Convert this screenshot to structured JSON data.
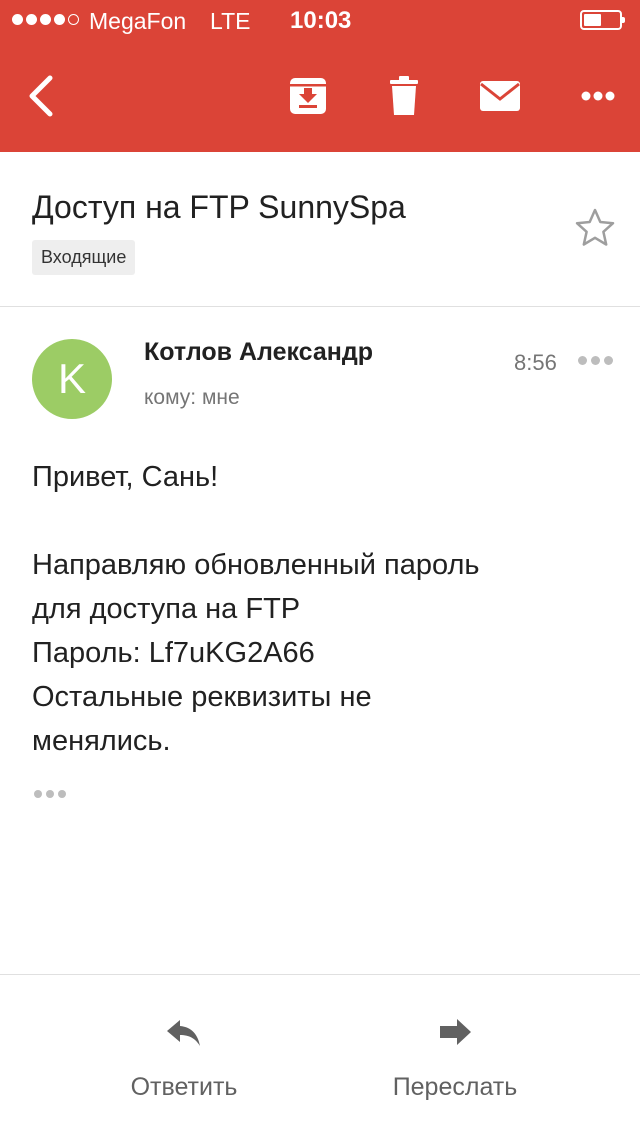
{
  "status_bar": {
    "carrier": "MegaFon",
    "network": "LTE",
    "time": "10:03",
    "signal_bars_filled": 4,
    "signal_bars_total": 5,
    "battery_level_fraction": 0.5
  },
  "toolbar": {
    "back_icon": "chevron-left-icon",
    "archive_icon": "archive-icon",
    "delete_icon": "trash-icon",
    "mark_unread_icon": "mail-icon",
    "more_icon": "more-horizontal-icon"
  },
  "email": {
    "subject": "Доступ на FTP SunnySpa",
    "label": "Входящие",
    "starred": false,
    "sender_name": "Котлов Александр",
    "sender_initial": "K",
    "recipient": "кому: мне",
    "time": "8:56",
    "body": {
      "greeting": "Привет, Сань!",
      "line1": "Направляю обновленный пароль",
      "line2": "для доступа на FTP",
      "line3": "Пароль: Lf7uKG2A66",
      "line4": "Остальные реквизиты не",
      "line5": "менялись."
    }
  },
  "actions": {
    "reply_label": "Ответить",
    "forward_label": "Переслать"
  },
  "colors": {
    "brand_red": "#db4437",
    "avatar_green": "#9ccc65"
  }
}
